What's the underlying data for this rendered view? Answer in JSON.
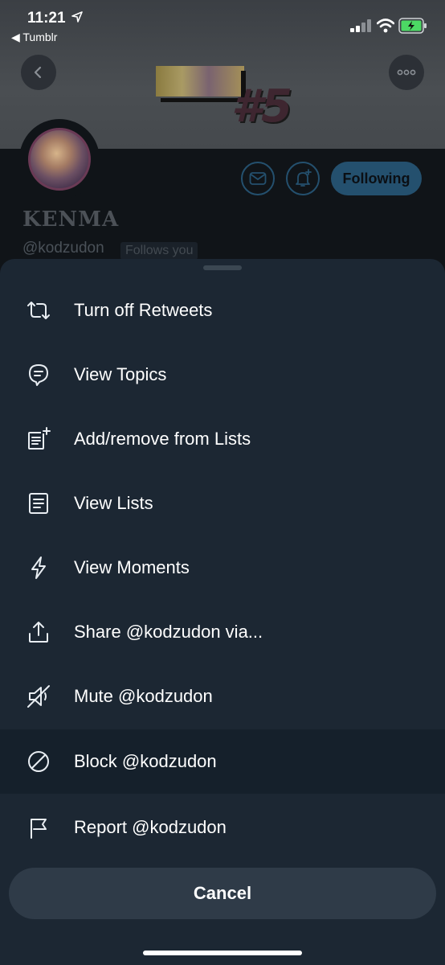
{
  "status_bar": {
    "time": "11:21",
    "back_app": "◀ Tumblr"
  },
  "banner": {
    "number": "#5"
  },
  "profile": {
    "name": "KENMA",
    "handle": "@kodzudon",
    "follows_you": "Follows you",
    "following_label": "Following"
  },
  "menu": {
    "items": [
      {
        "label": "Turn off Retweets",
        "icon": "retweet-icon"
      },
      {
        "label": "View Topics",
        "icon": "topics-icon"
      },
      {
        "label": "Add/remove from Lists",
        "icon": "list-add-icon"
      },
      {
        "label": "View Lists",
        "icon": "lists-icon"
      },
      {
        "label": "View Moments",
        "icon": "lightning-icon"
      },
      {
        "label": "Share @kodzudon via...",
        "icon": "share-icon"
      },
      {
        "label": "Mute @kodzudon",
        "icon": "mute-icon"
      },
      {
        "label": "Block @kodzudon",
        "icon": "block-icon"
      },
      {
        "label": "Report @kodzudon",
        "icon": "flag-icon"
      }
    ],
    "cancel_label": "Cancel"
  },
  "colors": {
    "sheet_bg": "#1c2733",
    "highlight_row": "#15202b",
    "accent_blue": "#24506e",
    "icon_stroke": "#e8edf2"
  }
}
